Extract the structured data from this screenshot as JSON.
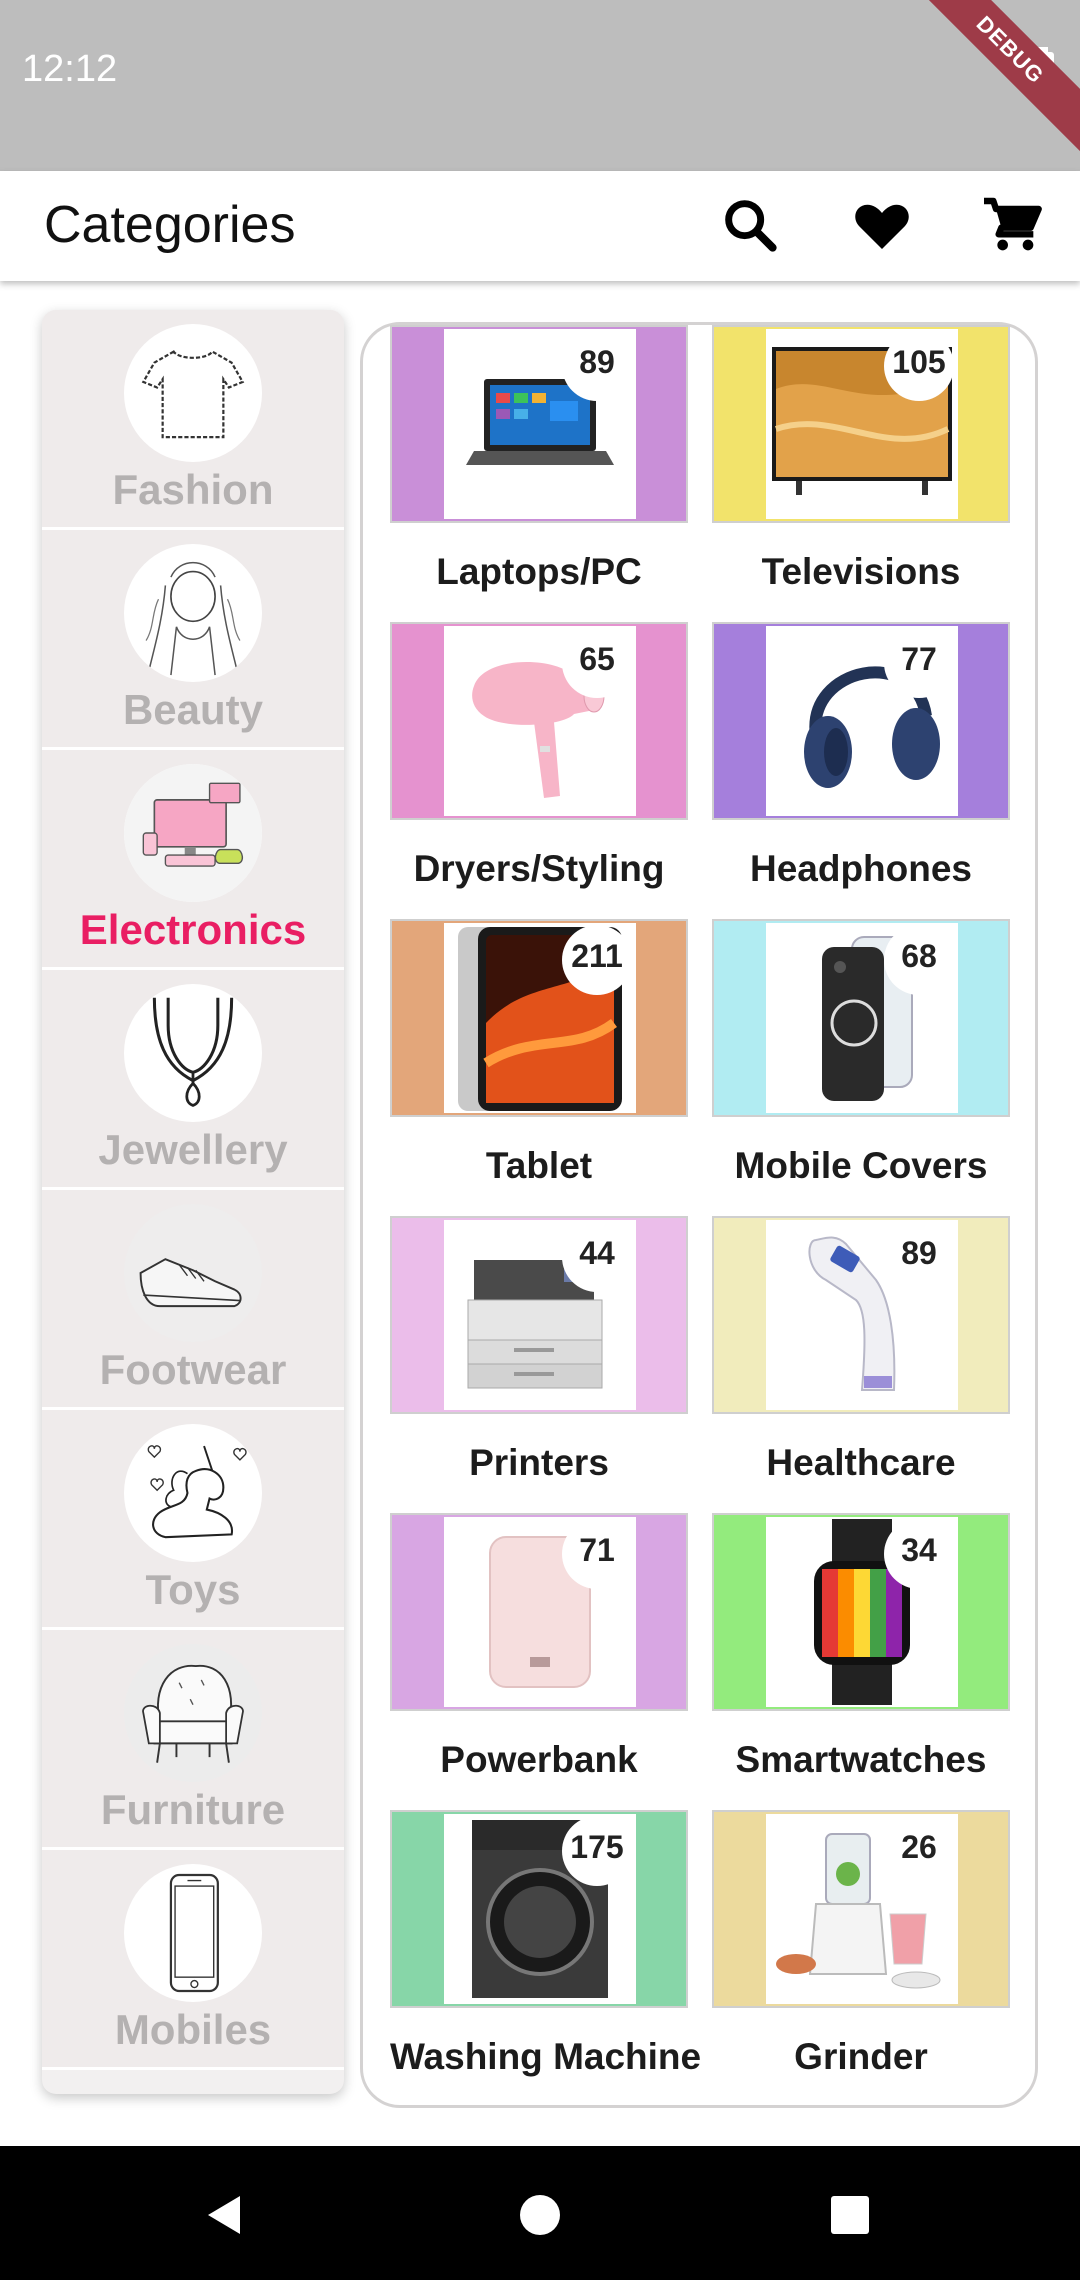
{
  "status_bar": {
    "time": "12:12",
    "debug_label": "DEBUG"
  },
  "app_bar": {
    "title": "Categories",
    "icons": [
      "search-icon",
      "heart-icon",
      "cart-icon"
    ]
  },
  "sidebar": {
    "items": [
      {
        "label": "Fashion",
        "active": false,
        "icon": "tshirt-icon"
      },
      {
        "label": "Beauty",
        "active": false,
        "icon": "beauty-sketch-icon"
      },
      {
        "label": "Electronics",
        "active": true,
        "icon": "devices-icon"
      },
      {
        "label": "Jewellery",
        "active": false,
        "icon": "necklace-icon"
      },
      {
        "label": "Footwear",
        "active": false,
        "icon": "shoe-icon"
      },
      {
        "label": "Toys",
        "active": false,
        "icon": "unicorn-icon"
      },
      {
        "label": "Furniture",
        "active": false,
        "icon": "armchair-icon"
      },
      {
        "label": "Mobiles",
        "active": false,
        "icon": "phone-icon"
      }
    ]
  },
  "grid": {
    "items": [
      {
        "label": "Laptops/PC",
        "count": "89",
        "bg": "#c98fd8",
        "icon": "laptop-icon"
      },
      {
        "label": "Televisions",
        "count": "105",
        "bg": "#f2e36b",
        "icon": "tv-icon"
      },
      {
        "label": "Dryers/Styling",
        "count": "65",
        "bg": "#e592cf",
        "icon": "hair-dryer-icon"
      },
      {
        "label": "Headphones",
        "count": "77",
        "bg": "#a57fdc",
        "icon": "headphones-icon"
      },
      {
        "label": "Tablet",
        "count": "211",
        "bg": "#e3a67a",
        "icon": "tablet-icon"
      },
      {
        "label": "Mobile Covers",
        "count": "68",
        "bg": "#b1ecf2",
        "icon": "phone-case-icon"
      },
      {
        "label": "Printers",
        "count": "44",
        "bg": "#ebbdea",
        "icon": "printer-icon"
      },
      {
        "label": "Healthcare",
        "count": "89",
        "bg": "#f1ecbc",
        "icon": "thermometer-icon"
      },
      {
        "label": "Powerbank",
        "count": "71",
        "bg": "#d8a6e3",
        "icon": "powerbank-icon"
      },
      {
        "label": "Smartwatches",
        "count": "34",
        "bg": "#93eb7d",
        "icon": "smartwatch-icon"
      },
      {
        "label": "Washing Machine",
        "count": "175",
        "bg": "#87d6a8",
        "icon": "washing-machine-icon"
      },
      {
        "label": "Grinder",
        "count": "26",
        "bg": "#ecda9d",
        "icon": "food-processor-icon"
      }
    ]
  },
  "colors": {
    "accent": "#e91e63",
    "inactive_label": "#b4b1b1"
  }
}
